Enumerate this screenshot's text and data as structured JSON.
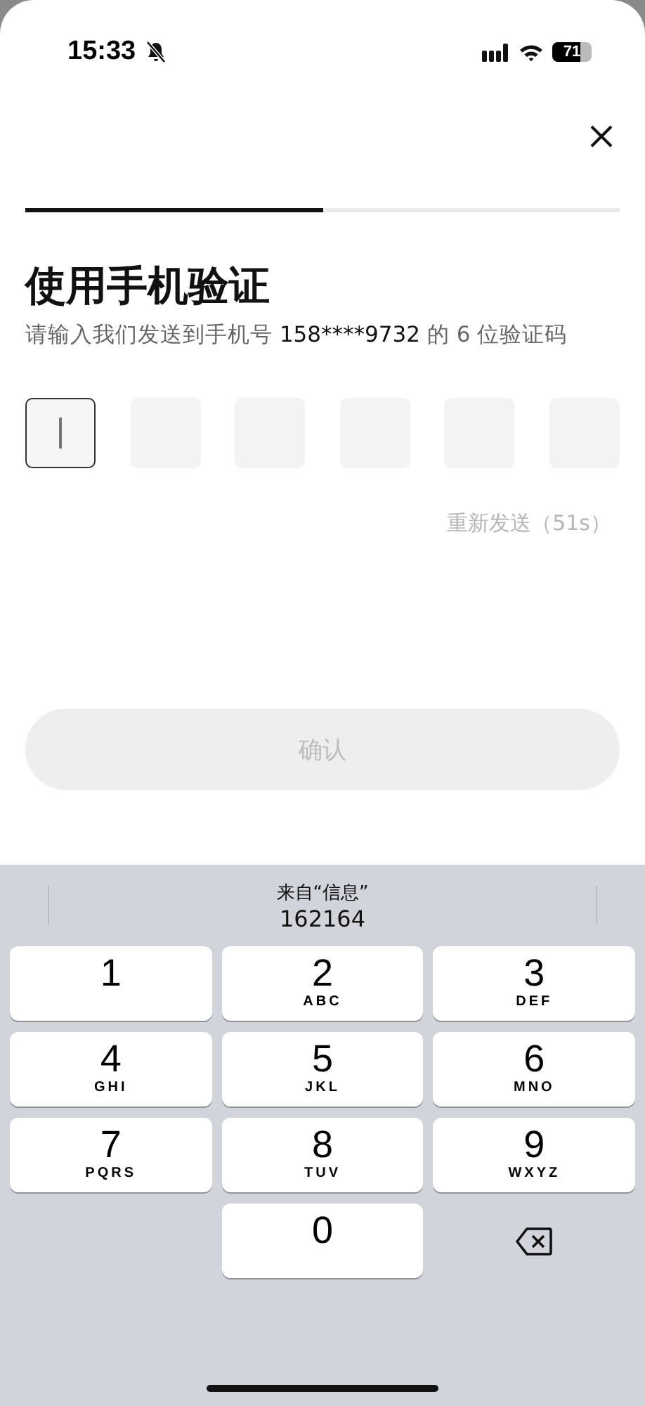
{
  "status_bar": {
    "time": "15:33",
    "battery": "71"
  },
  "progress": {
    "level": 0.5
  },
  "title": "使用手机验证",
  "subtitle": {
    "before": "请输入我们发送到手机号 ",
    "phone": "158****9732",
    "after": " 的 6 位验证码"
  },
  "code_boxes": [
    {
      "selected": true
    },
    {
      "selected": false
    },
    {
      "selected": false
    },
    {
      "selected": false
    },
    {
      "selected": false
    },
    {
      "selected": false
    }
  ],
  "resend": "重新发送（51s）",
  "confirm": {
    "label": "确认",
    "disabled": true
  },
  "suggestion": {
    "source": "来自“信息”",
    "code": "162164"
  },
  "keys": [
    {
      "kind": "digit",
      "digit": "1"
    },
    {
      "kind": "digit",
      "digit": "2",
      "letters": "ABC"
    },
    {
      "kind": "digit",
      "digit": "3",
      "letters": "DEF"
    },
    {
      "kind": "digit",
      "digit": "4",
      "letters": "GHI"
    },
    {
      "kind": "digit",
      "digit": "5",
      "letters": "JKL"
    },
    {
      "kind": "digit",
      "digit": "6",
      "letters": "MNO"
    },
    {
      "kind": "digit",
      "digit": "7",
      "letters": "PQRS"
    },
    {
      "kind": "digit",
      "digit": "8",
      "letters": "TUV"
    },
    {
      "kind": "digit",
      "digit": "9",
      "letters": "WXYZ"
    },
    {
      "kind": "blank"
    },
    {
      "kind": "digit",
      "digit": "0"
    },
    {
      "kind": "delete"
    }
  ]
}
